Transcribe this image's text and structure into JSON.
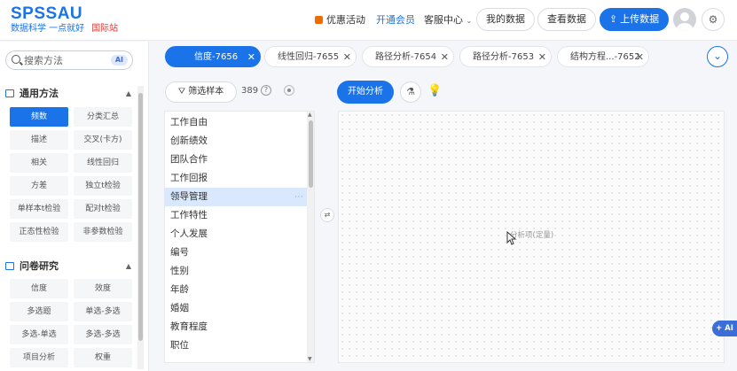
{
  "header": {
    "logo": "SPSSAU",
    "slogan": "数据科学 一点就好",
    "intl_label": "国际站",
    "promo_label": "优惠活动",
    "vip_label": "开通会员",
    "service_label": "客服中心",
    "my_data_label": "我的数据",
    "view_data_label": "查看数据",
    "upload_label": "上传数据"
  },
  "sidebar": {
    "search": {
      "placeholder": "搜索方法",
      "ai_badge": "AI"
    },
    "sections": [
      {
        "title": "通用方法",
        "items": [
          "频数",
          "分类汇总",
          "描述",
          "交叉(卡方)",
          "相关",
          "线性回归",
          "方差",
          "独立t检验",
          "单样本t检验",
          "配对t检验",
          "正态性检验",
          "非参数检验"
        ]
      },
      {
        "title": "问卷研究",
        "items": [
          "信度",
          "效度",
          "多选题",
          "单选-多选",
          "多选-单选",
          "多选-多选",
          "项目分析",
          "权重"
        ]
      }
    ],
    "active_item": "频数"
  },
  "tabs": [
    {
      "label": "信度-7656"
    },
    {
      "label": "线性回归-7655"
    },
    {
      "label": "路径分析-7654"
    },
    {
      "label": "路径分析-7653"
    },
    {
      "label": "结构方程...-7652"
    }
  ],
  "variables": {
    "filter_label": "筛选样本",
    "count": "389",
    "help": "?",
    "items": [
      "工作自由",
      "创新绩效",
      "团队合作",
      "工作回报",
      "领导管理",
      "工作特性",
      "个人发展",
      "编号",
      "性别",
      "年龄",
      "婚姻",
      "教育程度",
      "职位"
    ],
    "selected": "领导管理"
  },
  "analysis": {
    "start_label": "开始分析",
    "placeholder": "分析项(定量)",
    "ai_label": "+ AI"
  },
  "colors": {
    "primary": "#1a73e8",
    "accent_red": "#e53935",
    "promo": "#ef6c00"
  }
}
